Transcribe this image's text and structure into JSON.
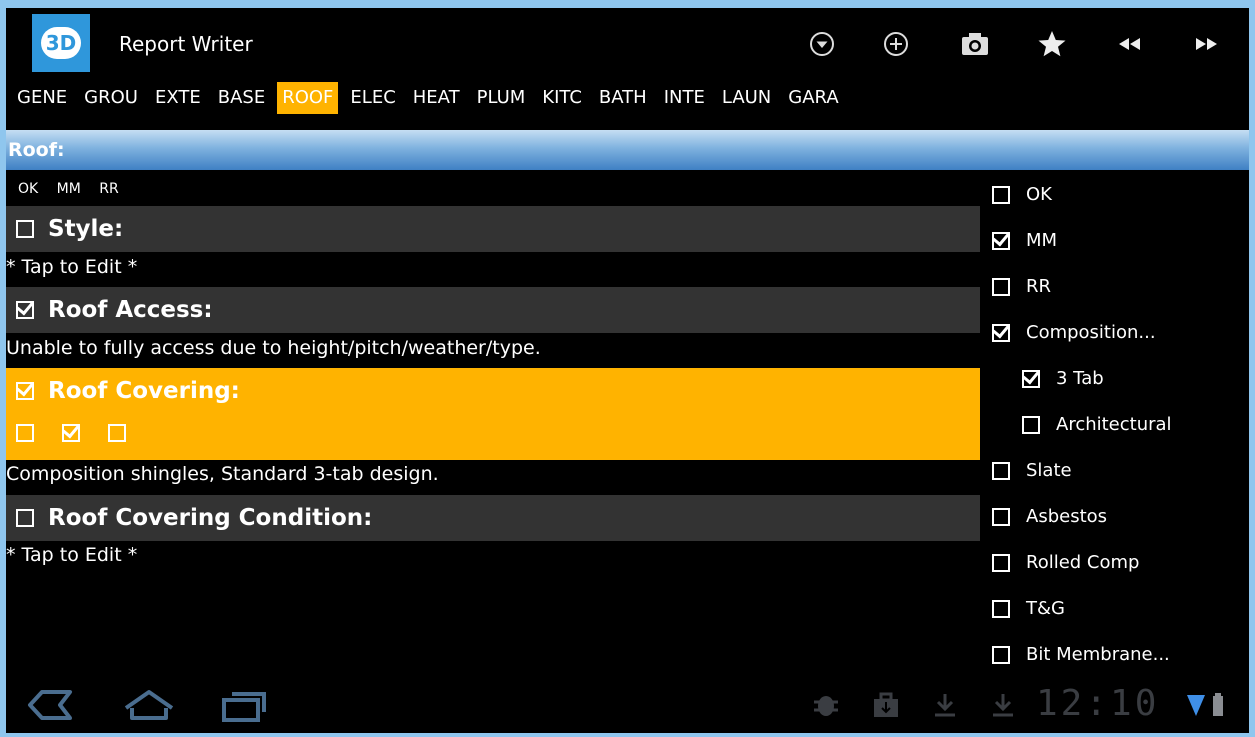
{
  "app": {
    "title": "Report Writer",
    "logo_text": "3D"
  },
  "actionbar": {
    "icons": [
      "dropdown-circle-icon",
      "add-circle-icon",
      "camera-icon",
      "star-icon",
      "rewind-icon",
      "fast-forward-icon"
    ]
  },
  "tabs": [
    {
      "label": "GENE",
      "active": false
    },
    {
      "label": "GROU",
      "active": false
    },
    {
      "label": "EXTE",
      "active": false
    },
    {
      "label": "BASE",
      "active": false
    },
    {
      "label": "ROOF",
      "active": true
    },
    {
      "label": "ELEC",
      "active": false
    },
    {
      "label": "HEAT",
      "active": false
    },
    {
      "label": "PLUM",
      "active": false
    },
    {
      "label": "KITC",
      "active": false
    },
    {
      "label": "BATH",
      "active": false
    },
    {
      "label": "INTE",
      "active": false
    },
    {
      "label": "LAUN",
      "active": false
    },
    {
      "label": "GARA",
      "active": false
    }
  ],
  "section": {
    "title": "Roof:",
    "columns": [
      "OK",
      "MM",
      "RR"
    ]
  },
  "items": [
    {
      "title": "Style:",
      "checked": false,
      "description": "* Tap to Edit *"
    },
    {
      "title": "Roof Access:",
      "checked": true,
      "description": "Unable to fully access due to height/pitch/weather/type."
    },
    {
      "title": "Roof Covering:",
      "checked": true,
      "description": "Composition shingles, Standard 3-tab design.",
      "rating": {
        "ok": false,
        "mm": true,
        "rr": false
      }
    },
    {
      "title": "Roof Covering Condition:",
      "checked": false,
      "description": "* Tap to Edit *"
    }
  ],
  "options": [
    {
      "label": "OK",
      "checked": false,
      "indent": false
    },
    {
      "label": "MM",
      "checked": true,
      "indent": false
    },
    {
      "label": "RR",
      "checked": false,
      "indent": false
    },
    {
      "label": "Composition...",
      "checked": true,
      "indent": false
    },
    {
      "label": "3 Tab",
      "checked": true,
      "indent": true
    },
    {
      "label": "Architectural",
      "checked": false,
      "indent": true
    },
    {
      "label": "Slate",
      "checked": false,
      "indent": false
    },
    {
      "label": "Asbestos",
      "checked": false,
      "indent": false
    },
    {
      "label": "Rolled Comp",
      "checked": false,
      "indent": false
    },
    {
      "label": "T&G",
      "checked": false,
      "indent": false
    },
    {
      "label": "Bit Membrane...",
      "checked": false,
      "indent": false
    }
  ],
  "system": {
    "clock": "12:10"
  },
  "colors": {
    "accent": "#ffb300",
    "header_blue": "#3f80c4",
    "item_bar": "#333333"
  }
}
